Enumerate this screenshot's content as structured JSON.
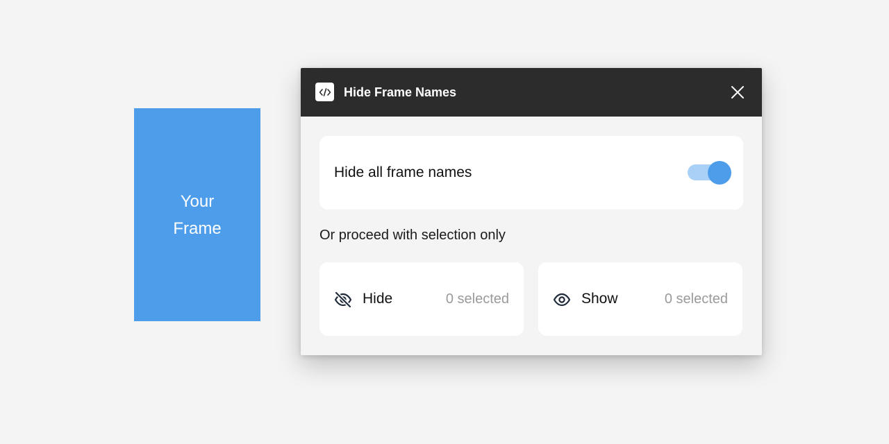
{
  "canvas": {
    "frame_label": "Your Frame"
  },
  "plugin": {
    "title": "Hide Frame Names",
    "icon": "code-icon",
    "close_icon": "close-icon",
    "hide_all": {
      "label": "Hide all frame names",
      "toggle_on": true
    },
    "selection_label": "Or proceed with selection only",
    "actions": [
      {
        "label": "Hide",
        "count": "0 selected",
        "icon": "eye-off-icon"
      },
      {
        "label": "Show",
        "count": "0 selected",
        "icon": "eye-icon"
      }
    ]
  },
  "colors": {
    "frame": "#4e9deb",
    "titlebar": "#2c2c2c",
    "accent": "#4e9deb",
    "toggle_track": "#a9d0f6",
    "muted_text": "#9a9a9a"
  }
}
